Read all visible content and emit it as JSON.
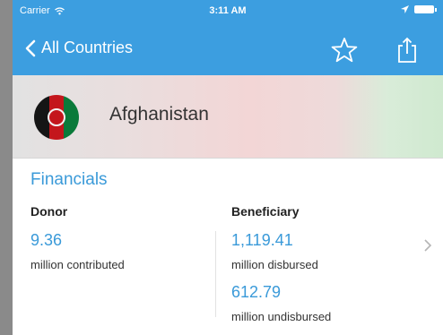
{
  "statusbar": {
    "carrier": "Carrier",
    "time": "3:11 AM"
  },
  "navbar": {
    "back_label": "All Countries",
    "icons": [
      "chevron-left-icon",
      "star-icon",
      "share-icon"
    ]
  },
  "country": {
    "name": "Afghanistan",
    "flag_icon": "afghanistan-flag-icon"
  },
  "financials": {
    "title": "Financials",
    "donor": {
      "header": "Donor",
      "value": "9.36",
      "caption": "million contributed"
    },
    "beneficiary": {
      "header": "Beneficiary",
      "disbursed_value": "1,119.41",
      "disbursed_caption": "million disbursed",
      "undisbursed_value": "612.79",
      "undisbursed_caption": "million undisbursed"
    }
  },
  "colors": {
    "accent": "#3c9ee0",
    "link": "#3a9ad9"
  }
}
